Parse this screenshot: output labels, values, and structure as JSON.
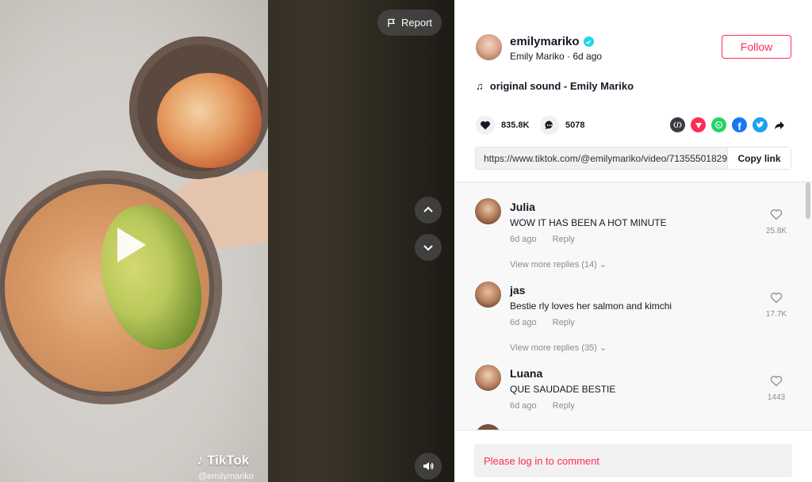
{
  "video": {
    "report_label": "Report",
    "brand_label": "TikTok",
    "watermark": "@emilymariko"
  },
  "author": {
    "username": "emilymariko",
    "display_name": "Emily Mariko",
    "separator": "·",
    "posted": "6d ago",
    "follow_label": "Follow"
  },
  "music": {
    "label": "original sound - Emily Mariko"
  },
  "stats": {
    "likes": "835.8K",
    "comments": "5078"
  },
  "share": {
    "icons": [
      "embed-icon",
      "friends-icon",
      "whatsapp-icon",
      "facebook-icon",
      "twitter-icon",
      "share-arrow-icon"
    ],
    "colors": {
      "embed": "#3a3b42",
      "friends": "#fe2c55",
      "whatsapp": "#25d366",
      "facebook": "#1877f2",
      "twitter": "#1da1f2"
    }
  },
  "link": {
    "url": "https://www.tiktok.com/@emilymariko/video/71355501829...",
    "copy_label": "Copy link"
  },
  "comments": [
    {
      "name": "Julia",
      "text": "WOW IT HAS BEEN A HOT MINUTE",
      "time": "6d ago",
      "reply": "Reply",
      "likes": "25.8K",
      "view_more": "View more replies (14)"
    },
    {
      "name": "jas",
      "text": "Bestie rly loves her salmon and kimchi",
      "time": "6d ago",
      "reply": "Reply",
      "likes": "17.7K",
      "view_more": "View more replies (35)"
    },
    {
      "name": "Luana",
      "text": "QUE SAUDADE BESTIE",
      "time": "6d ago",
      "reply": "Reply",
      "likes": "1443"
    }
  ],
  "login": {
    "prompt": "Please log in to comment"
  },
  "colors": {
    "accent": "#fe2c55",
    "verified": "#20d5ec"
  }
}
